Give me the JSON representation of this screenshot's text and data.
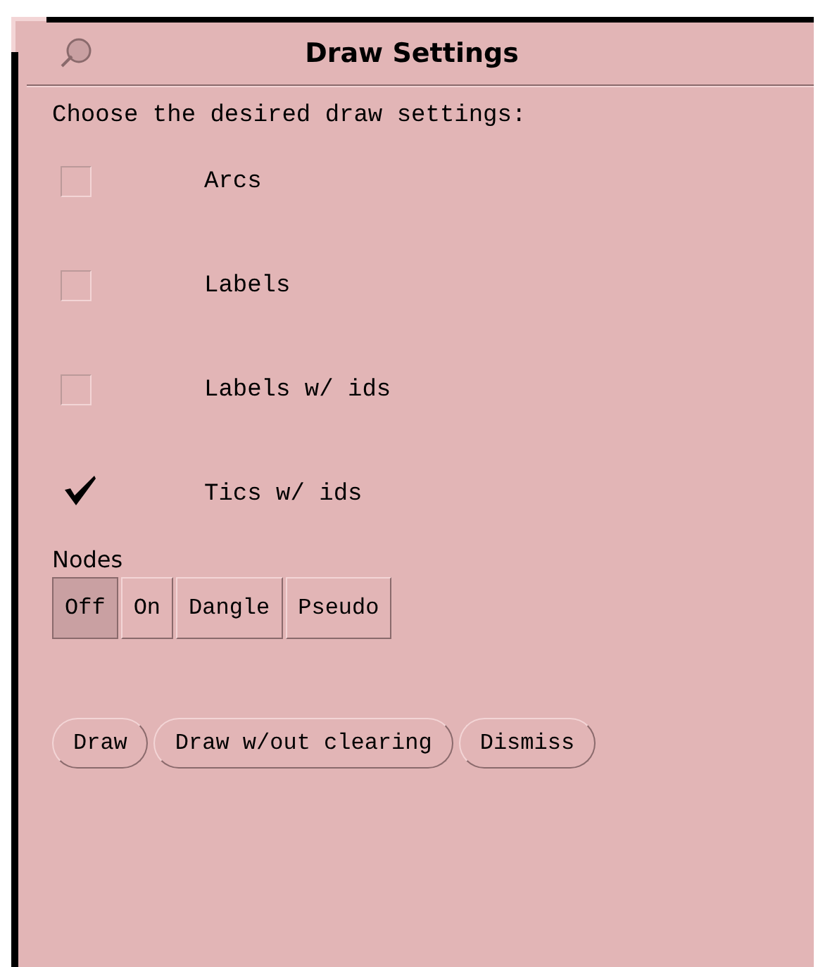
{
  "window": {
    "title": "Draw Settings"
  },
  "prompt": "Choose the desired draw settings:",
  "options": [
    {
      "label": "Arcs",
      "checked": false
    },
    {
      "label": "Labels",
      "checked": false
    },
    {
      "label": "Labels w/ ids",
      "checked": false
    },
    {
      "label": "Tics w/ ids",
      "checked": true
    }
  ],
  "nodes": {
    "label": "Nodes",
    "choices": [
      {
        "label": "Off",
        "selected": true
      },
      {
        "label": "On",
        "selected": false
      },
      {
        "label": "Dangle",
        "selected": false
      },
      {
        "label": "Pseudo",
        "selected": false
      }
    ]
  },
  "buttons": [
    "Draw",
    "Draw w/out clearing",
    "Dismiss"
  ]
}
